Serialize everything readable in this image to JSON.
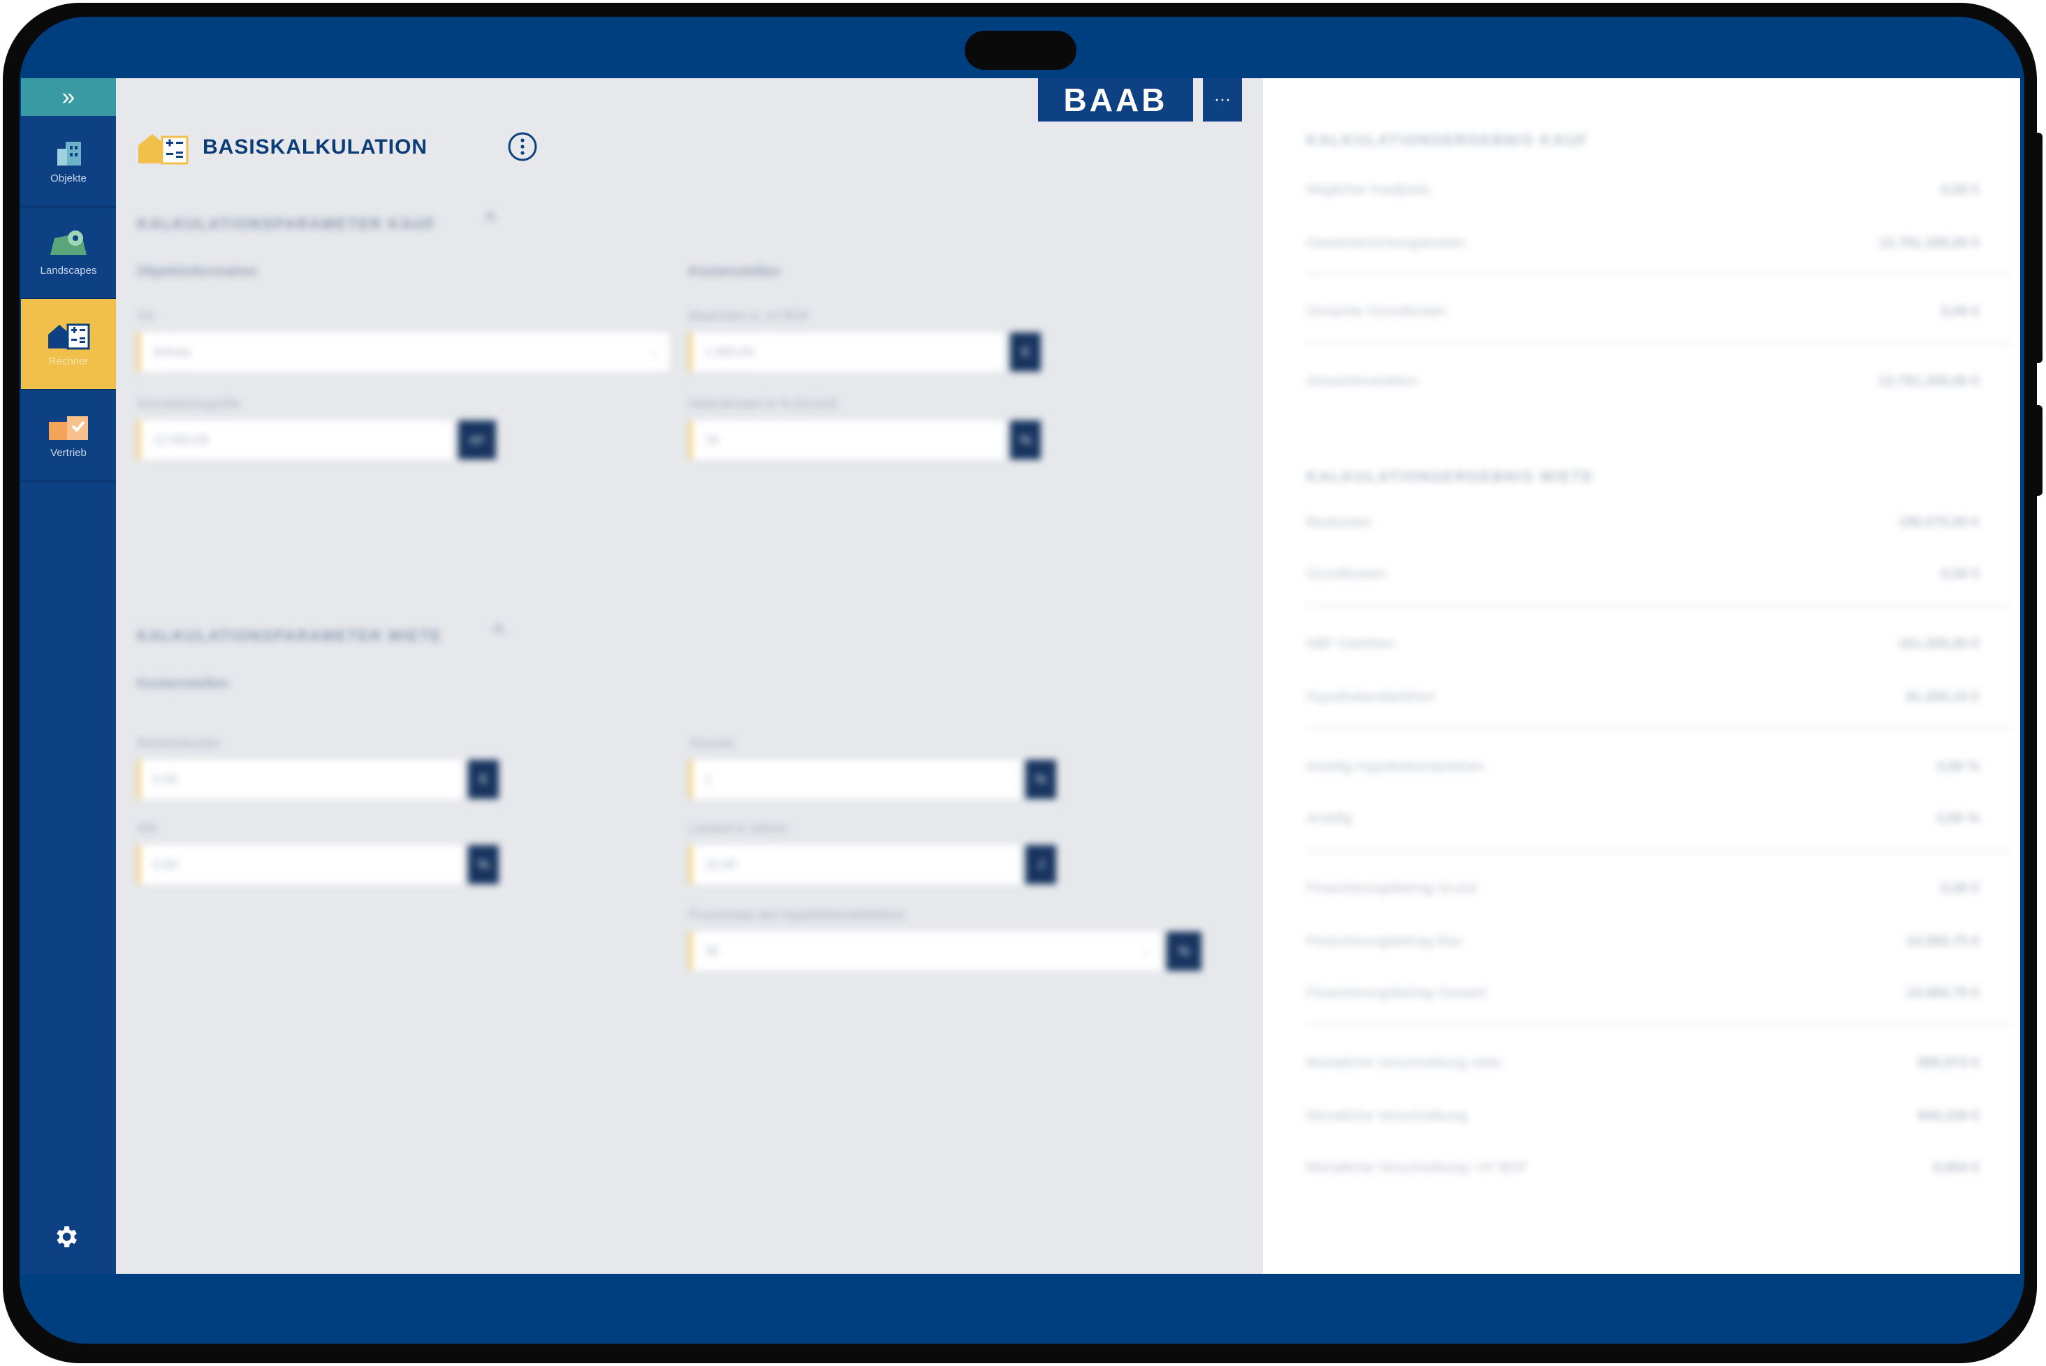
{
  "brand": {
    "logo_text": "BAAB",
    "more_label": "···"
  },
  "sidebar": {
    "toggle_label": "»",
    "items": [
      {
        "label": "Objekte",
        "icon": "building-icon",
        "active": false
      },
      {
        "label": "Landscapes",
        "icon": "map-pin-icon",
        "active": false
      },
      {
        "label": "Rechner",
        "icon": "calculator-house-icon",
        "active": true
      },
      {
        "label": "Vertrieb",
        "icon": "sales-box-icon",
        "active": false
      }
    ],
    "settings_icon": "gear-icon"
  },
  "page": {
    "title": "BASISKALKULATION",
    "info_icon": "info-icon"
  },
  "kauf": {
    "heading": "KALKULATIONSPARAMETER KAUF",
    "left_subheading": "Objektinformation",
    "right_subheading": "Kostenstellen",
    "fields": [
      {
        "label": "Ort",
        "value": "Anhaw"
      },
      {
        "label": "Grundstücksgröße",
        "value": "12.000,00",
        "button": "m²"
      },
      {
        "label": "Baukosten p. m² BGF",
        "value": "1.000,00",
        "button": "€"
      },
      {
        "label": "Nebenkosten in % (Grund)",
        "value": "16",
        "button": "%"
      }
    ]
  },
  "miete": {
    "heading": "KALKULATIONSPARAMETER MIETE",
    "subheading": "Kostenstellen",
    "fields": [
      {
        "label": "Betriebskosten",
        "value": "0,00",
        "button": "€"
      },
      {
        "label": "Zinssatz",
        "value": "1",
        "button": "%"
      },
      {
        "label": "AfA",
        "value": "0,00",
        "button": "%"
      },
      {
        "label": "Laufzeit in Jahren",
        "value": "15,00",
        "button": "J"
      },
      {
        "label": "Prozentsatz des Hypothekendarlehens",
        "value": "30",
        "button": "%"
      }
    ]
  },
  "results": {
    "kauf_heading": "KALKULATIONSERGEBNIS KAUF",
    "kauf_rows": [
      {
        "label": "Möglicher Kaufpreis",
        "value": "0,00 €"
      },
      {
        "label": "Gesamterrichtungskosten",
        "value": "12.781.200,00 €"
      },
      {
        "label": "Gesamte Grundkosten",
        "value": "0,00 €"
      },
      {
        "label": "Gesamtinvestition",
        "value": "12.781.200,00 €"
      }
    ],
    "miete_heading": "KALKULATIONSERGEBNIS MIETE",
    "miete_rows": [
      {
        "label": "Baukosten",
        "value": "196.075,00 €"
      },
      {
        "label": "Grundkosten",
        "value": "0,00 €"
      },
      {
        "label": "NBF Darlehen",
        "value": "101.200,00 €"
      },
      {
        "label": "Hypothekendarlehen",
        "value": "91.200,15 €"
      },
      {
        "label": "Anteilig Hypothekendarlehen",
        "value": "3,00 %"
      },
      {
        "label": "Anteilig",
        "value": "3,00 %"
      },
      {
        "label": "Finanzierungsbetrag Grund",
        "value": "0,00 €"
      },
      {
        "label": "Finanzierungsbetrag Bau",
        "value": "14.065,75 €"
      },
      {
        "label": "Finanzierungsbetrag Gesamt",
        "value": "14.065,75 €"
      },
      {
        "label": "Monatliche Verschreibung netto",
        "value": "885,073 €"
      },
      {
        "label": "Monatliche Verschreibung",
        "value": "944,109 €"
      },
      {
        "label": "Monatliche Verschreibung / m² BGF",
        "value": "0,004 €"
      }
    ]
  },
  "colors": {
    "primary": "#0d4183",
    "accent": "#f0c04a",
    "teal": "#3a9aa3",
    "bezel": "#003f7f"
  }
}
